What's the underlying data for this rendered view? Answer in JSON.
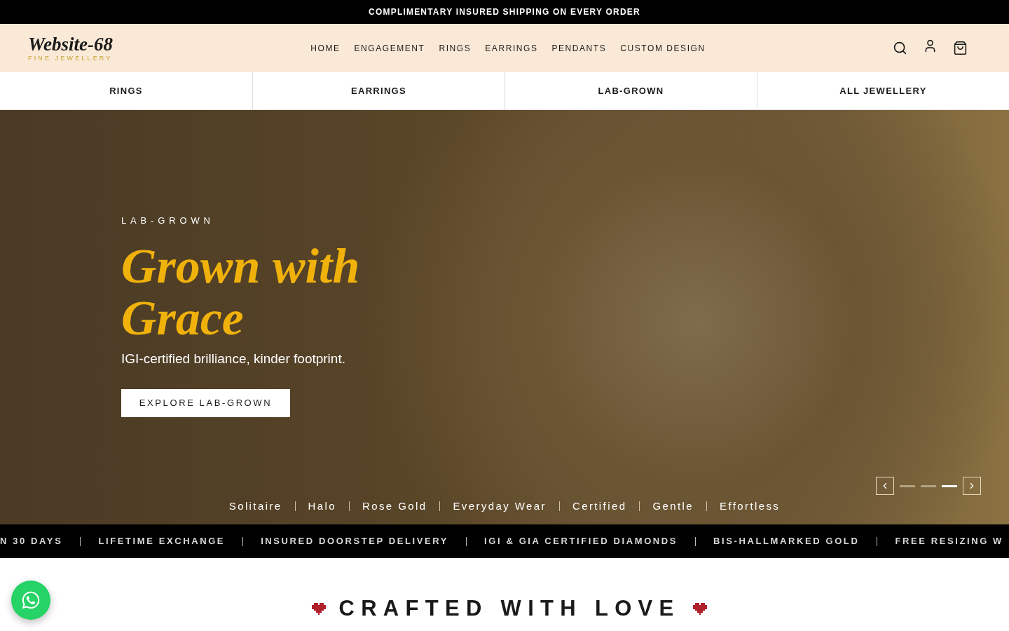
{
  "announcement": {
    "text": "COMPLIMENTARY INSURED SHIPPING ON EVERY ORDER"
  },
  "header": {
    "logo": {
      "name": "Website-68",
      "tagline": "FINE JEWELLERY"
    },
    "nav": [
      "HOME",
      "ENGAGEMENT",
      "RINGS",
      "EARRINGS",
      "PENDANTS",
      "CUSTOM DESIGN"
    ]
  },
  "category_bar": [
    "RINGS",
    "EARRINGS",
    "LAB-GROWN",
    "ALL JEWELLERY"
  ],
  "hero": {
    "eyebrow": "LAB-GROWN",
    "title": "Grown with Grace",
    "subtitle": "IGI-certified brilliance, kinder footprint.",
    "button": "EXPLORE LAB-GROWN",
    "slide_indicators": [
      {
        "selected": false
      },
      {
        "selected": false
      },
      {
        "selected": true
      }
    ],
    "tags": [
      "Solitaire",
      "Halo",
      "Rose Gold",
      "Everyday Wear",
      "Certified",
      "Gentle",
      "Effortless"
    ]
  },
  "trust_marquee": [
    "N 30 DAYS",
    "LIFETIME EXCHANGE",
    "INSURED DOORSTEP DELIVERY",
    "IGI & GIA CERTIFIED DIAMONDS",
    "BIS-HALLMARKED GOLD",
    "FREE RESIZING W"
  ],
  "section": {
    "heading": "CRAFTED WITH LOVE"
  }
}
